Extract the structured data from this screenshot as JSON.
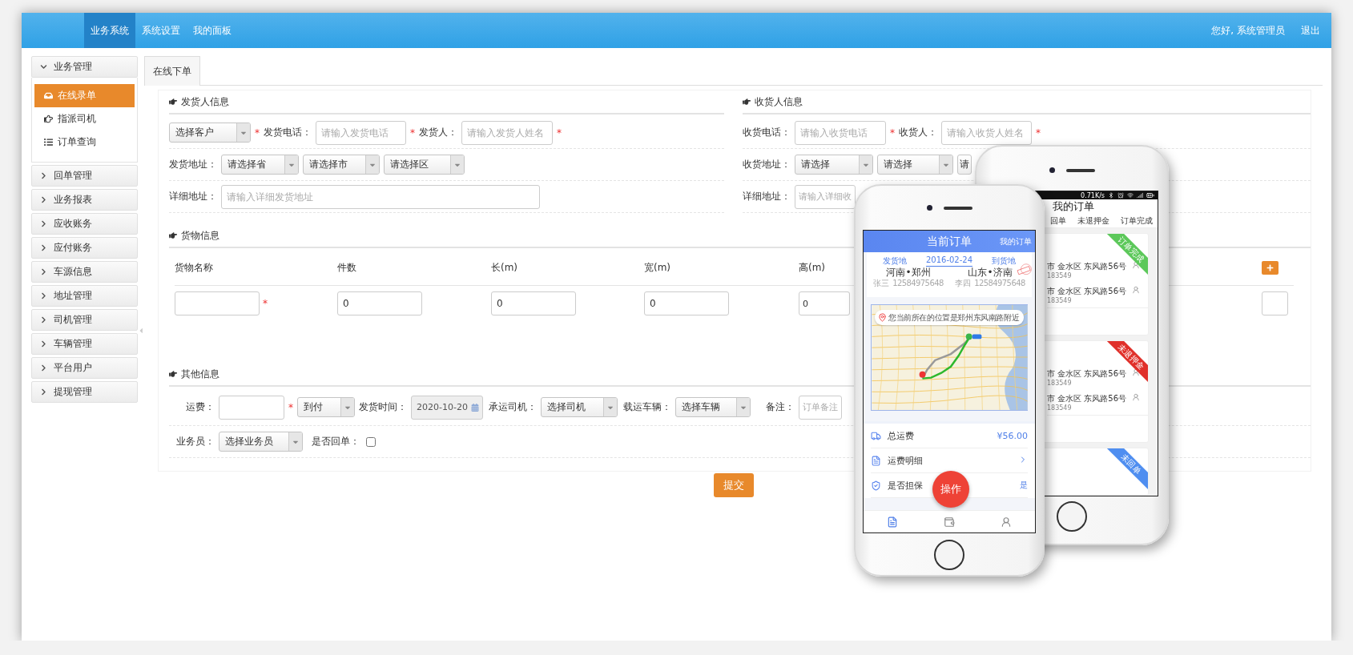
{
  "nav": {
    "tabs": [
      {
        "label": "业务系统",
        "selected": true
      },
      {
        "label": "系统设置",
        "selected": false
      },
      {
        "label": "我的面板",
        "selected": false
      }
    ],
    "greeting": "您好, 系统管理员",
    "logout": "退出"
  },
  "sidebar": {
    "groups": [
      {
        "label": "业务管理",
        "expanded": true,
        "items": [
          {
            "label": "在线录单",
            "selected": true
          },
          {
            "label": "指派司机",
            "selected": false
          },
          {
            "label": "订单查询",
            "selected": false
          }
        ]
      },
      {
        "label": "回单管理",
        "expanded": false
      },
      {
        "label": "业务报表",
        "expanded": false
      },
      {
        "label": "应收账务",
        "expanded": false
      },
      {
        "label": "应付账务",
        "expanded": false
      },
      {
        "label": "车源信息",
        "expanded": false
      },
      {
        "label": "地址管理",
        "expanded": false
      },
      {
        "label": "司机管理",
        "expanded": false
      },
      {
        "label": "车辆管理",
        "expanded": false
      },
      {
        "label": "平台用户",
        "expanded": false
      },
      {
        "label": "提现管理",
        "expanded": false
      }
    ]
  },
  "page_tabs": [
    {
      "label": "在线下单",
      "selected": true
    }
  ],
  "sender": {
    "title": "发货人信息",
    "rows": [
      {
        "items": [
          {
            "kind": "select",
            "value": "选择客户"
          },
          {
            "kind": "required",
            "text": "*"
          },
          {
            "kind": "label",
            "text": "发货电话："
          },
          {
            "kind": "input",
            "placeholder": "请输入发货电话"
          },
          {
            "kind": "required",
            "text": "*"
          },
          {
            "kind": "label",
            "text": "发货人："
          },
          {
            "kind": "input",
            "placeholder": "请输入发货人姓名"
          },
          {
            "kind": "required",
            "text": "*"
          }
        ]
      },
      {
        "items": [
          {
            "kind": "label",
            "text": "发货地址："
          },
          {
            "kind": "select",
            "value": "请选择省"
          },
          {
            "kind": "select",
            "value": "请选择市"
          },
          {
            "kind": "select",
            "value": "请选择区"
          }
        ]
      },
      {
        "items": [
          {
            "kind": "label",
            "text": "详细地址："
          },
          {
            "kind": "input",
            "placeholder": "请输入详细发货地址"
          }
        ]
      }
    ]
  },
  "receiver": {
    "title": "收货人信息",
    "rows": [
      {
        "items": [
          {
            "kind": "label",
            "text": "收货电话："
          },
          {
            "kind": "input",
            "placeholder": "请输入收货电话"
          },
          {
            "kind": "required",
            "text": "*"
          },
          {
            "kind": "label",
            "text": "收货人："
          },
          {
            "kind": "input",
            "placeholder": "请输入收货人姓名"
          },
          {
            "kind": "required",
            "text": "*"
          }
        ]
      },
      {
        "items": [
          {
            "kind": "label",
            "text": "收货地址："
          },
          {
            "kind": "select",
            "value": "请选择"
          },
          {
            "kind": "select",
            "value": "请选择"
          },
          {
            "kind": "select",
            "value": "请"
          }
        ]
      },
      {
        "items": [
          {
            "kind": "label",
            "text": "详细地址："
          },
          {
            "kind": "input",
            "placeholder": "请输入详细收"
          }
        ]
      }
    ]
  },
  "goods": {
    "title": "货物信息",
    "columns": [
      "货物名称",
      "件数",
      "长(m)",
      "宽(m)",
      "高(m)"
    ],
    "inputs": [
      {
        "required": true,
        "mark": "*"
      },
      {
        "value": "0"
      },
      {
        "value": "0"
      },
      {
        "value": "0"
      },
      {
        "value": "0"
      }
    ]
  },
  "other": {
    "title": "其他信息",
    "rows": [
      {
        "items": [
          {
            "kind": "label",
            "text": "运费："
          },
          {
            "kind": "input"
          },
          {
            "kind": "required",
            "text": "*"
          },
          {
            "kind": "select",
            "value": "到付"
          },
          {
            "kind": "label",
            "text": "发货时间："
          },
          {
            "kind": "date",
            "value": "2020-10-20",
            "disabled": true
          },
          {
            "kind": "label",
            "text": "承运司机："
          },
          {
            "kind": "select",
            "value": "选择司机"
          },
          {
            "kind": "label",
            "text": "载运车辆："
          },
          {
            "kind": "select",
            "value": "选择车辆"
          },
          {
            "kind": "label",
            "text": "备注："
          },
          {
            "kind": "textarea",
            "placeholder": "订单备注"
          }
        ]
      },
      {
        "items": [
          {
            "kind": "label",
            "text": "业务员："
          },
          {
            "kind": "select",
            "value": "选择业务员"
          },
          {
            "kind": "label",
            "text": "是否回单："
          },
          {
            "kind": "checkbox",
            "checked": false
          }
        ]
      }
    ]
  },
  "submit": "提交",
  "front_phone": {
    "title": "当前订单",
    "link": "我的订单",
    "from_label": "发货地",
    "date": "2016-02-24",
    "to_label": "到货地",
    "from_city": "河南•郑州",
    "to_city": "山东•济南",
    "from_contact": "张三  12584975648",
    "to_contact": "李四  12584975648",
    "location": "您当前所在的位置是郑州东风南路附近",
    "rows": [
      {
        "kind": "amount",
        "label": "总运费",
        "value": "¥56.00"
      },
      {
        "kind": "link",
        "label": "运费明细"
      },
      {
        "kind": "value",
        "label": "是否担保",
        "value": "是"
      }
    ],
    "action": "操作",
    "tabbar": [
      {
        "selected": true
      },
      {
        "selected": false
      },
      {
        "selected": false
      }
    ]
  },
  "back_phone": {
    "speed": "0.71K/s",
    "title": "我的订单",
    "tabs": [
      "回单",
      "未退押金",
      "订单完成"
    ],
    "cards": [
      {
        "tag": "订单完成",
        "color": "#5cc85a",
        "rows": [
          {
            "address": "市 金水区 东风路56号",
            "phone": "183549"
          },
          {
            "address": "市 金水区 东风路56号",
            "phone": "183549"
          }
        ]
      },
      {
        "tag": "未退押金",
        "color": "#e0302a",
        "rows": [
          {
            "address": "市 金水区 东风路56号",
            "phone": "183549"
          },
          {
            "address": "市 金水区 东风路56号",
            "phone": "183549"
          }
        ]
      },
      {
        "tag": "未回单",
        "color": "#4f8ef0"
      }
    ]
  }
}
